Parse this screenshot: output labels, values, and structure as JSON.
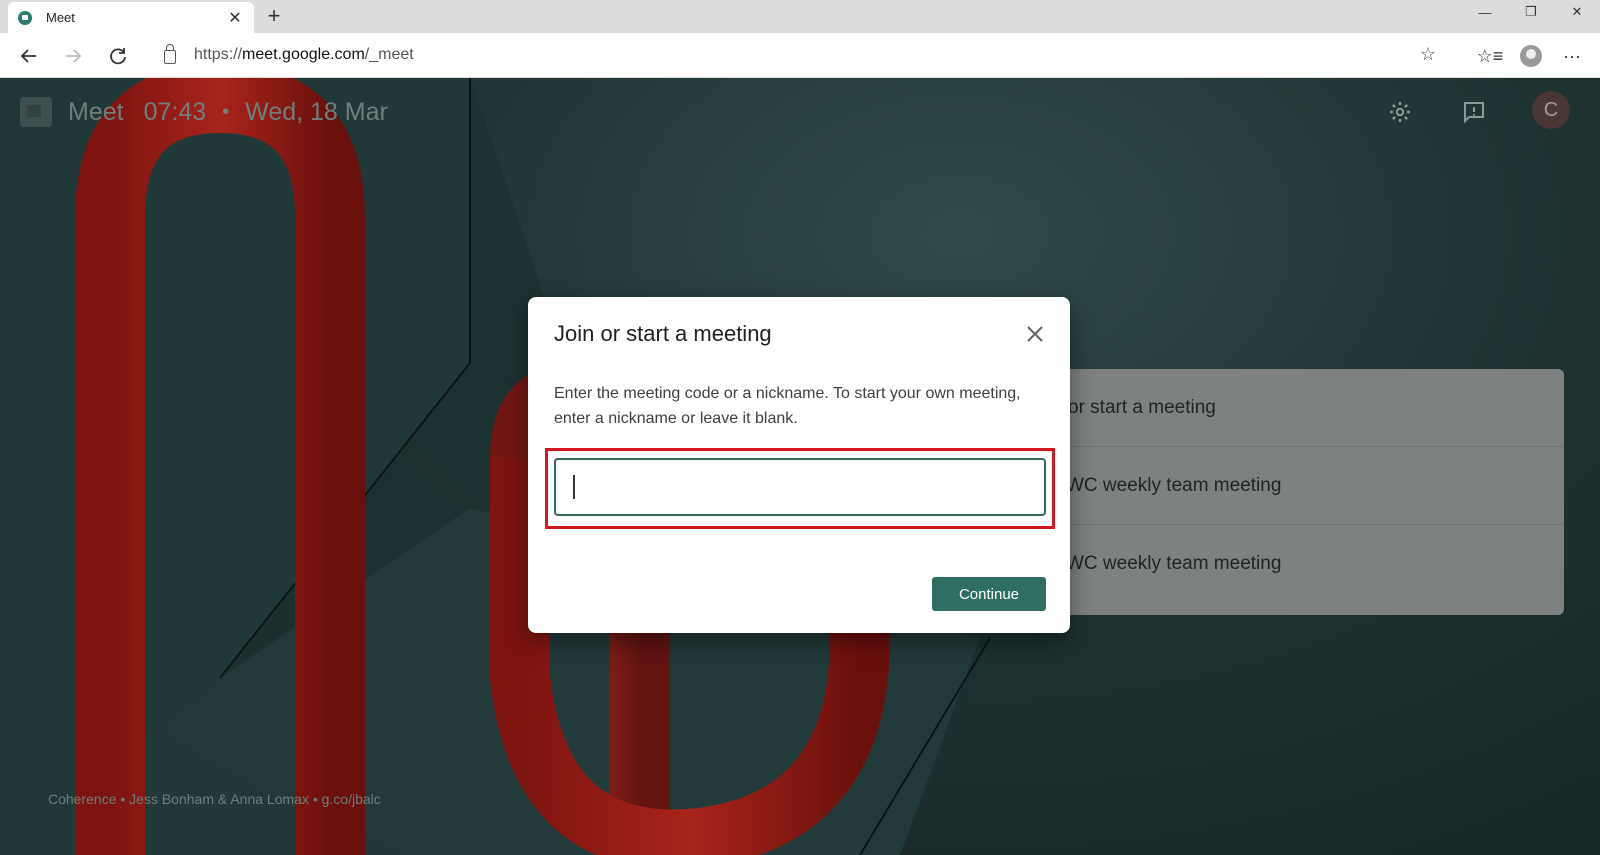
{
  "browser": {
    "tab_title": "Meet",
    "url_prefix": "https://",
    "url_host": "meet.google.com",
    "url_path": "/_meet"
  },
  "meet": {
    "title": "Meet",
    "time": "07:43",
    "separator": "•",
    "date": "Wed, 18 Mar",
    "avatar_letter": "C",
    "meetings": [
      {
        "label": "or start a meeting"
      },
      {
        "label": "WC weekly team meeting"
      },
      {
        "label": "WC weekly team meeting"
      }
    ],
    "credits": "Coherence  •  Jess Bonham & Anna Lomax  •  g.co/jbalc"
  },
  "dialog": {
    "title": "Join or start a meeting",
    "description": "Enter the meeting code or a nickname. To start your own meeting, enter a nickname or leave it blank.",
    "input_value": "",
    "continue_label": "Continue"
  },
  "colors": {
    "accent": "#2f6e63",
    "highlight": "#d4171f"
  }
}
